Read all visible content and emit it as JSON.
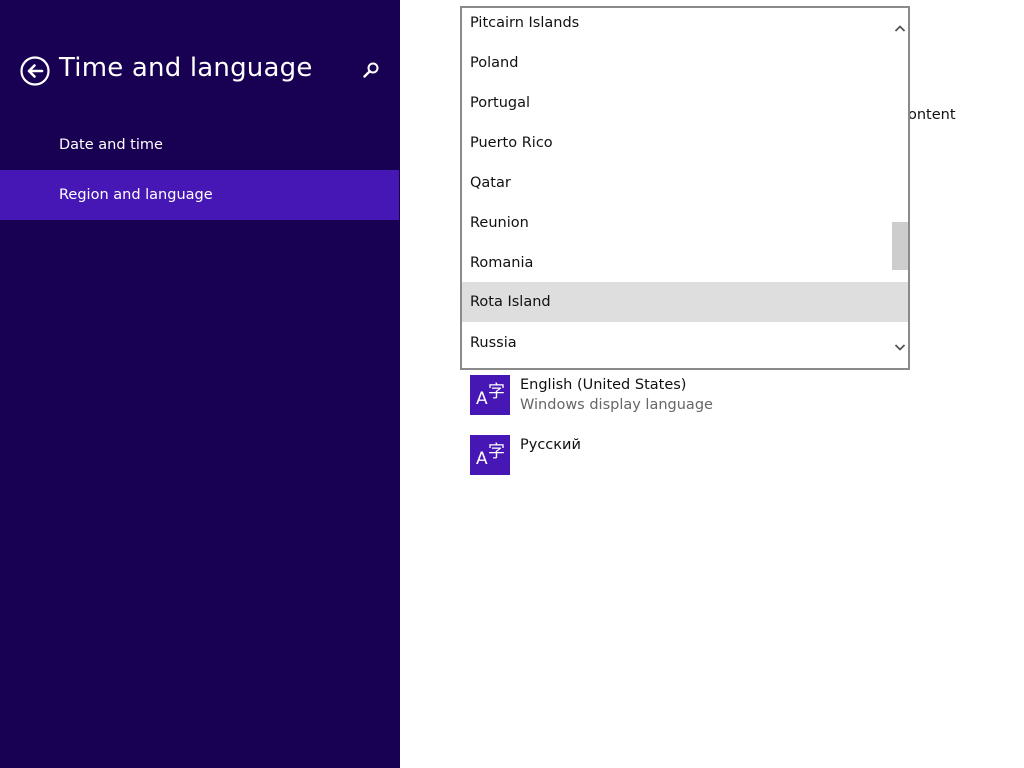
{
  "sidebar": {
    "title": "Time and language",
    "nav": [
      {
        "label": "Date and time",
        "selected": false
      },
      {
        "label": "Region and language",
        "selected": true
      }
    ]
  },
  "main": {
    "partial_text": "ontent",
    "country_dropdown": {
      "options": [
        "Pitcairn Islands",
        "Poland",
        "Portugal",
        "Puerto Rico",
        "Qatar",
        "Reunion",
        "Romania",
        "Rota Island",
        "Russia"
      ],
      "highlighted": "Rota Island"
    },
    "languages": [
      {
        "name": "English (United States)",
        "subtitle": "Windows display language",
        "icon": "language-icon"
      },
      {
        "name": "Русский",
        "subtitle": "",
        "icon": "language-icon"
      }
    ],
    "icon_glyphs": {
      "latin": "A",
      "cjk": "字"
    }
  },
  "colors": {
    "sidebar_bg": "#180052",
    "accent": "#4617b4",
    "highlight": "#dedede"
  }
}
